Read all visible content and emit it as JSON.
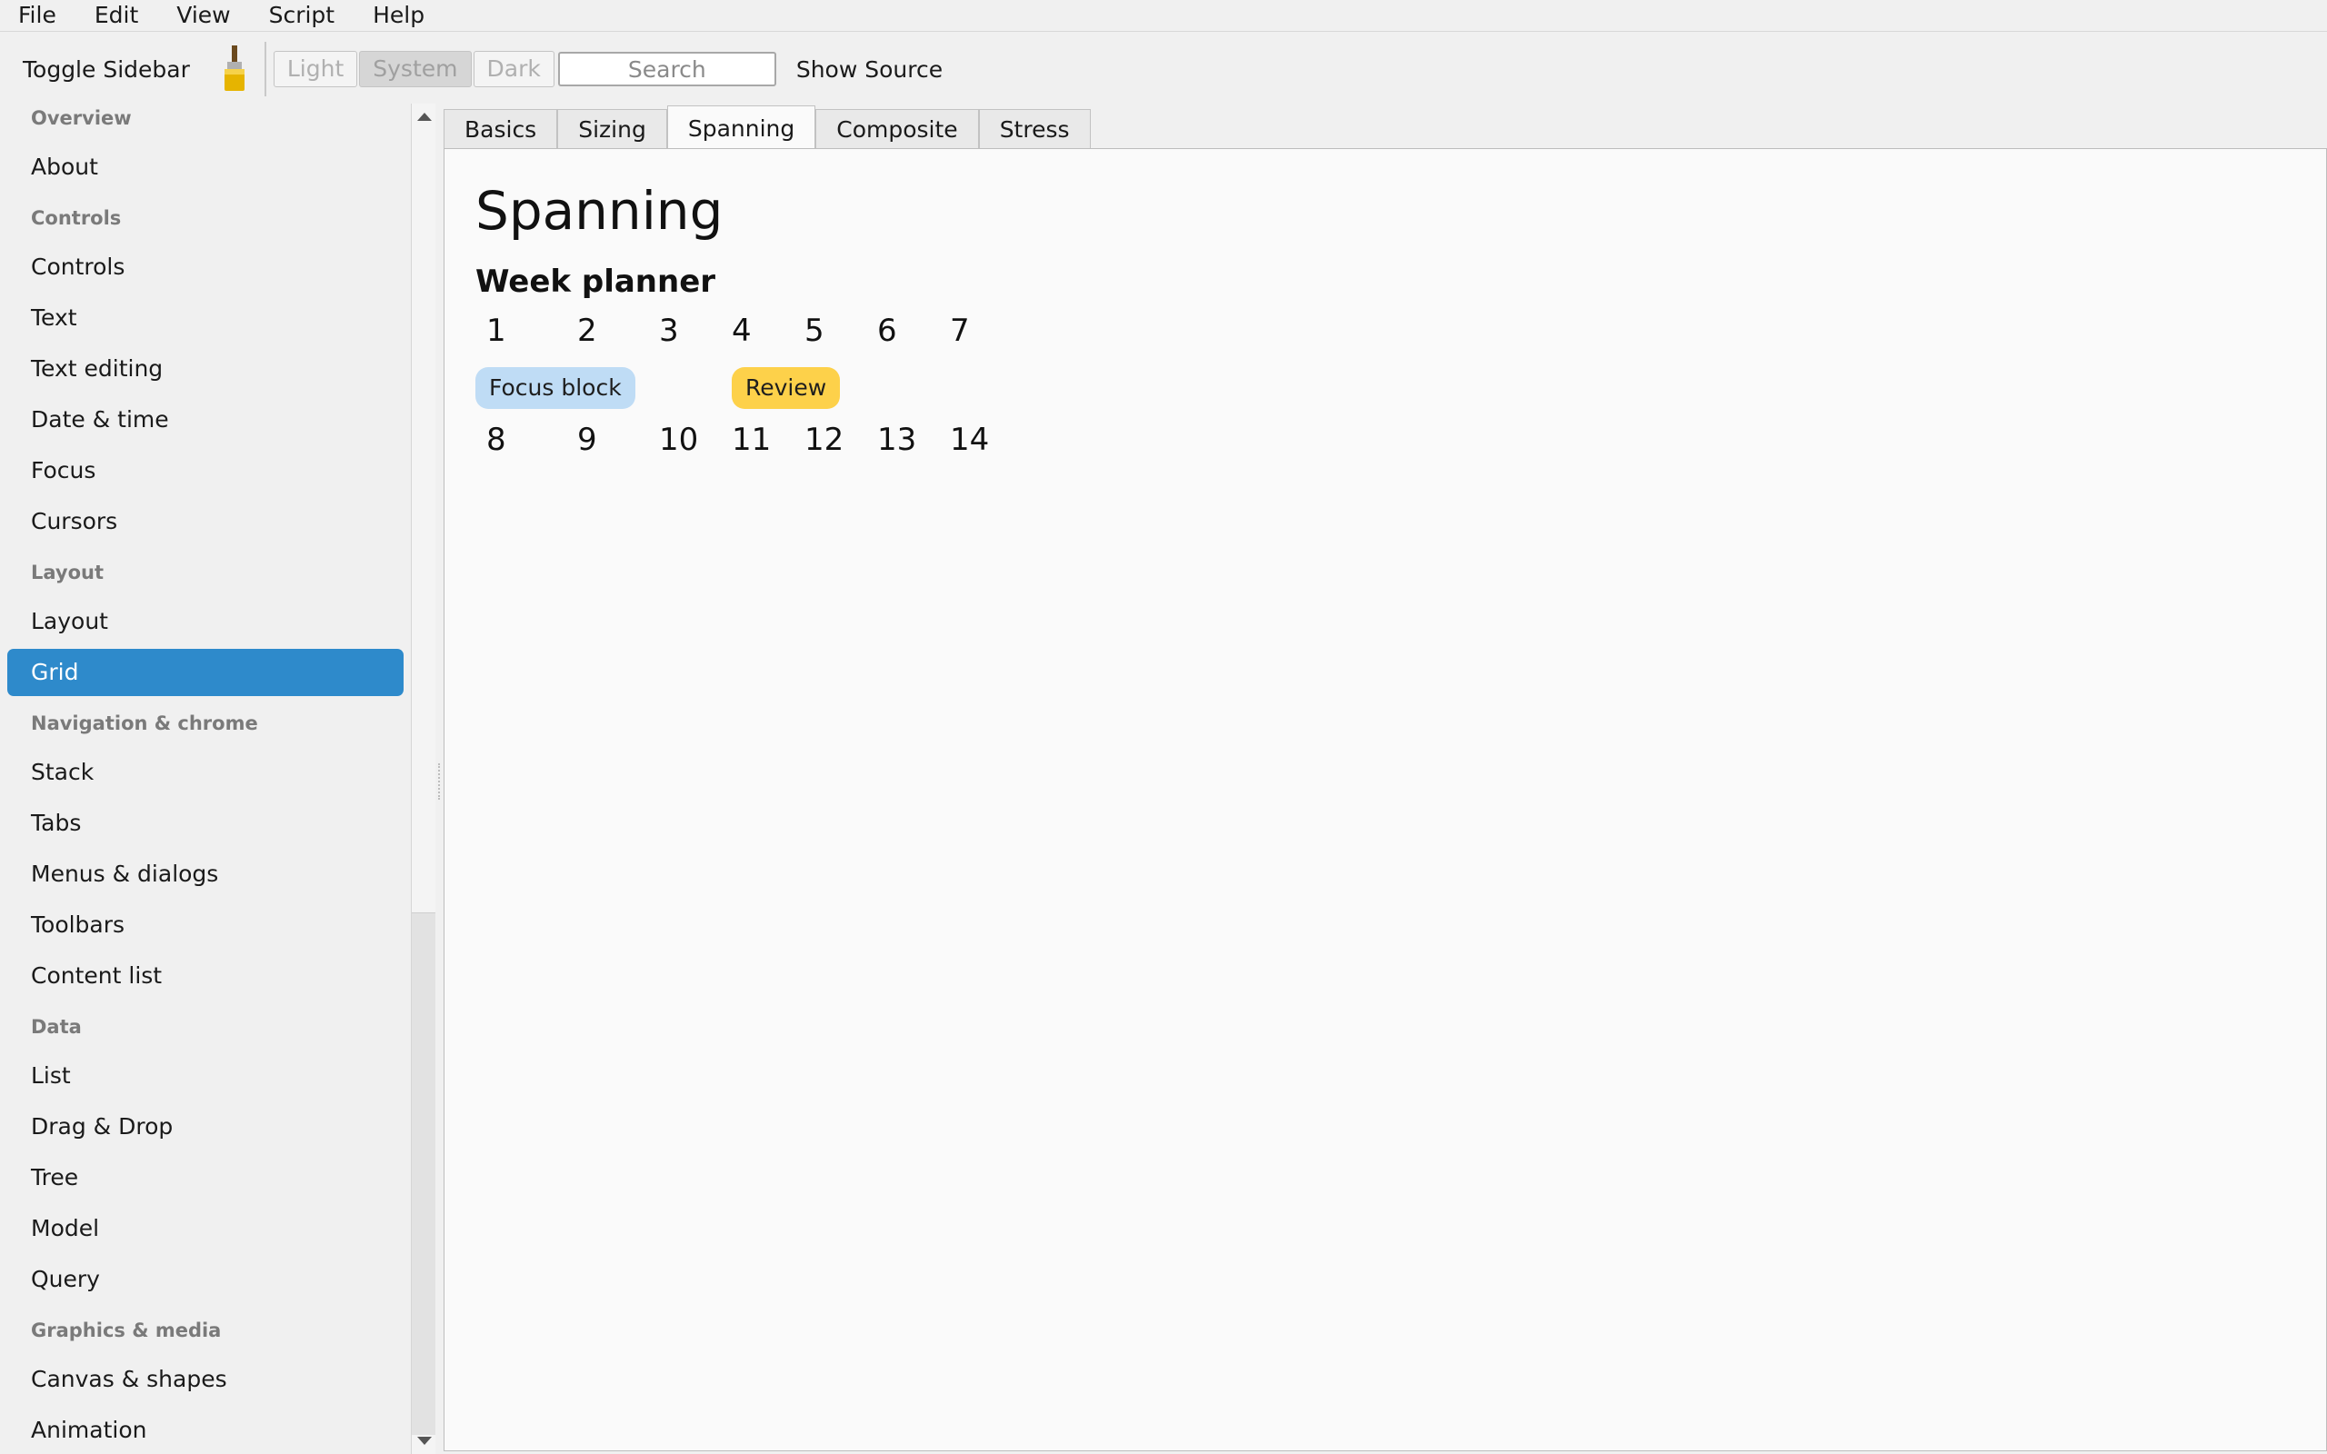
{
  "menu": [
    "File",
    "Edit",
    "View",
    "Script",
    "Help"
  ],
  "toolbar": {
    "toggle_sidebar": "Toggle Sidebar",
    "brush_icon": "paintbrush-icon",
    "themes": [
      "Light",
      "System",
      "Dark"
    ],
    "active_theme": "System",
    "search_placeholder": "Search",
    "show_source": "Show Source"
  },
  "sidebar": {
    "selected": "Grid",
    "sections": [
      "Overview",
      "Controls",
      "Layout",
      "Navigation & chrome",
      "Data",
      "Graphics & media"
    ],
    "items": [
      "About",
      "Controls",
      "Text",
      "Text editing",
      "Date & time",
      "Focus",
      "Cursors",
      "Layout",
      "Grid",
      "Stack",
      "Tabs",
      "Menus & dialogs",
      "Toolbars",
      "Content list",
      "List",
      "Drag & Drop",
      "Tree",
      "Model",
      "Query",
      "Canvas & shapes",
      "Animation"
    ]
  },
  "tabs": [
    "Basics",
    "Sizing",
    "Spanning",
    "Composite",
    "Stress"
  ],
  "active_tab": "Spanning",
  "content": {
    "title": "Spanning",
    "section": "Week planner",
    "week1": [
      "1",
      "2",
      "3",
      "4",
      "5",
      "6",
      "7"
    ],
    "events": [
      {
        "label": "Focus block",
        "color": "#bfdcf5"
      },
      {
        "label": "Review",
        "color": "#fdd14a"
      }
    ],
    "week2": [
      "8",
      "9",
      "10",
      "11",
      "12",
      "13",
      "14"
    ]
  },
  "colors": {
    "accent": "#2e8acb"
  }
}
